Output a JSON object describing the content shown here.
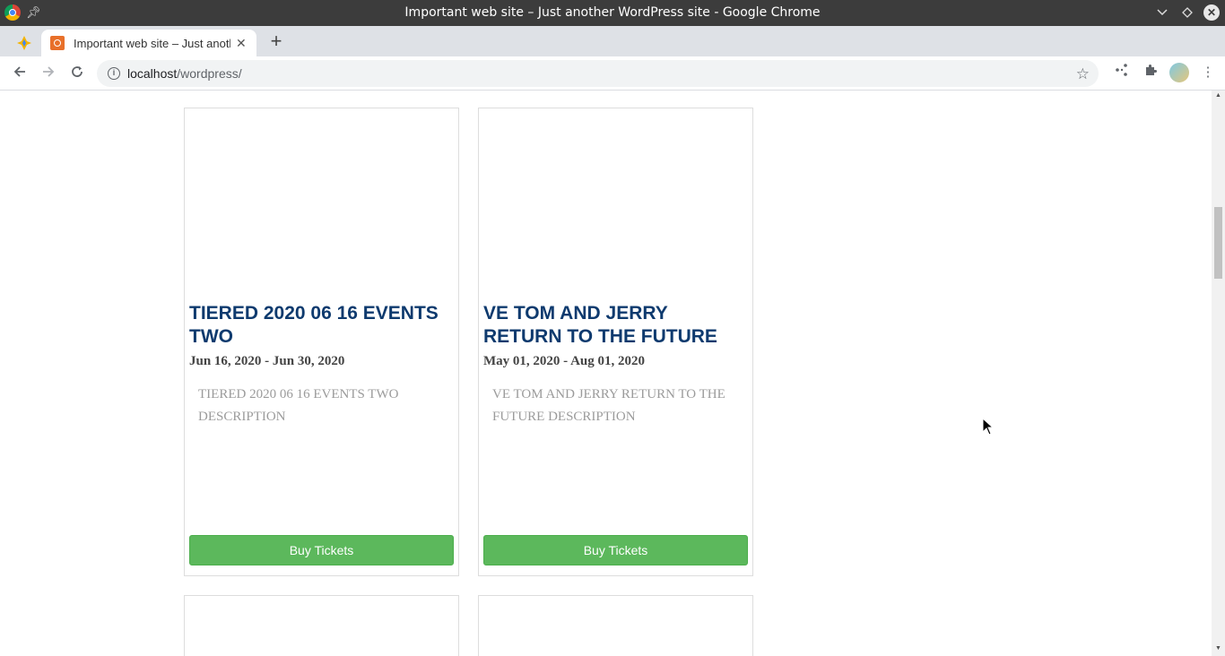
{
  "window": {
    "title": "Important web site – Just another WordPress site - Google Chrome"
  },
  "tabs": [
    {
      "label": "Important web site – Just another WordPress site",
      "active": true
    }
  ],
  "toolbar": {
    "url_host": "localhost",
    "url_path": "/wordpress/"
  },
  "events": [
    {
      "title": "TIERED 2020 06 16 EVENTS TWO",
      "date": "Jun 16, 2020 - Jun 30, 2020",
      "description": "TIERED 2020 06 16 EVENTS TWO DESCRIPTION",
      "button_label": "Buy Tickets"
    },
    {
      "title": "VE TOM AND JERRY RETURN TO THE FUTURE",
      "date": "May 01, 2020 - Aug 01, 2020",
      "description": "VE TOM AND JERRY RETURN TO THE FUTURE DESCRIPTION",
      "button_label": "Buy Tickets"
    }
  ],
  "colors": {
    "title_color": "#0e3a6e",
    "button_green": "#5cb85c",
    "titlebar": "#3c3c3c"
  },
  "icons": [
    "chrome-logo-icon",
    "pin-icon",
    "minimize-icon",
    "maximize-icon",
    "close-icon",
    "back-icon",
    "forward-icon",
    "reload-icon",
    "info-icon",
    "star-icon",
    "media-icon",
    "extensions-icon",
    "menu-icon"
  ]
}
